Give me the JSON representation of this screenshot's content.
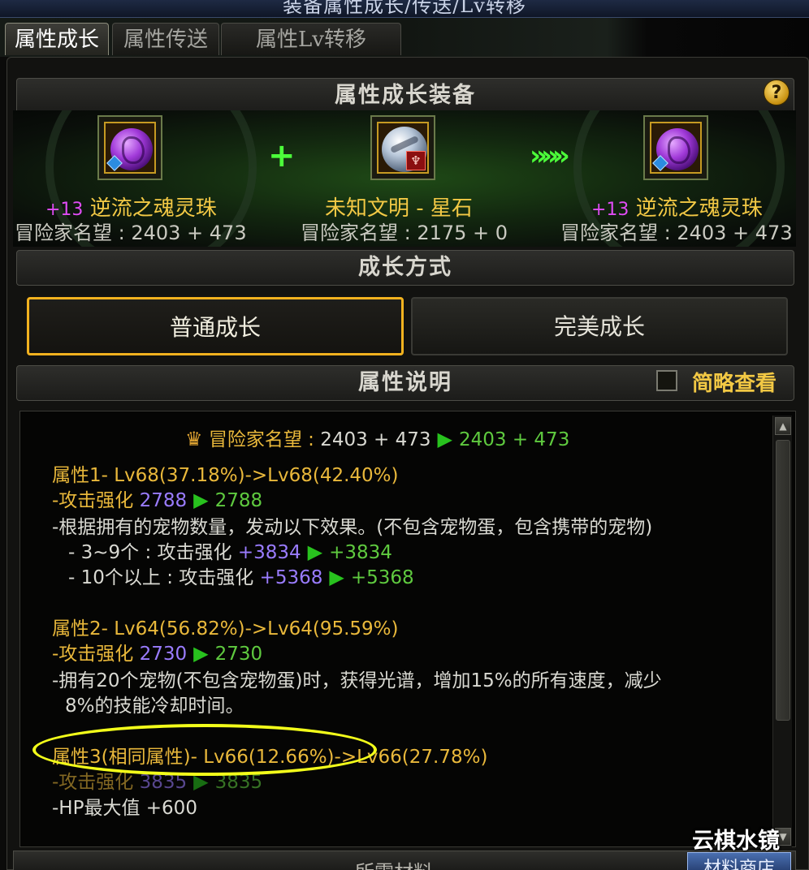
{
  "window": {
    "title": "装备属性成长/传送/Lv转移"
  },
  "tabs": [
    {
      "label": "属性成长",
      "active": true
    },
    {
      "label": "属性传送",
      "active": false
    },
    {
      "label": "属性Lv转移",
      "active": false
    }
  ],
  "equip_section": {
    "title": "属性成长装备",
    "help_icon": "?",
    "source": {
      "plus_level": "+13",
      "name": "逆流之魂灵珠",
      "stat_label": "冒险家名望",
      "stat_value": "2403 + 473",
      "icon": "purple-rose-orb-icon"
    },
    "material": {
      "name": "未知文明 - 星石",
      "stat_label": "冒险家名望",
      "stat_value": "2175 + 0",
      "icon": "star-stone-orb-icon"
    },
    "result": {
      "plus_level": "+13",
      "name": "逆流之魂灵珠",
      "stat_label": "冒险家名望",
      "stat_value": "2403 + 473",
      "icon": "purple-rose-orb-icon"
    },
    "combine_symbol": "+",
    "arrow_symbol": "»»»"
  },
  "growth": {
    "title": "成长方式",
    "modes": [
      {
        "label": "普通成长",
        "selected": true
      },
      {
        "label": "完美成长",
        "selected": false
      }
    ]
  },
  "description": {
    "title": "属性说明",
    "simple_view_label": "简略查看",
    "simple_view_checked": false,
    "fame": {
      "label": "冒险家名望",
      "before": "2403 + 473",
      "after": "2403 + 473"
    },
    "attr1": {
      "header": "属性1- Lv68(37.18%)->Lv68(42.40%)",
      "atk_label": "-攻击强化",
      "atk_before": "2788",
      "atk_after": "2788",
      "effect_text": "-根据拥有的宠物数量，发动以下效果。(不包含宠物蛋，包含携带的宠物)",
      "tier1_label": "- 3~9个 : 攻击强化",
      "tier1_before": "+3834",
      "tier1_after": "+3834",
      "tier2_label": "- 10个以上 : 攻击强化",
      "tier2_before": "+5368",
      "tier2_after": "+5368"
    },
    "attr2": {
      "header": "属性2- Lv64(56.82%)->Lv64(95.59%)",
      "atk_label": "-攻击强化",
      "atk_before": "2730",
      "atk_after": "2730",
      "effect_line1": "-拥有20个宠物(不包含宠物蛋)时，获得光谱，增加15%的所有速度，减少",
      "effect_line2": "8%的技能冷却时间。"
    },
    "attr3": {
      "header": "属性3(相同属性)- Lv66(12.66%)->Lv66(27.78%)",
      "atk_label": "-攻击强化",
      "atk_before": "3835",
      "atk_after": "3835",
      "hp_text": "-HP最大值 +600"
    }
  },
  "footer": {
    "section_title": "所需材料",
    "material_button": "材料商店"
  },
  "watermark": "云棋水镜",
  "colors": {
    "accent_gold": "#f2b21f",
    "highlight_ellipse": "#f3ff1a",
    "arrow_green": "#28c21e"
  }
}
